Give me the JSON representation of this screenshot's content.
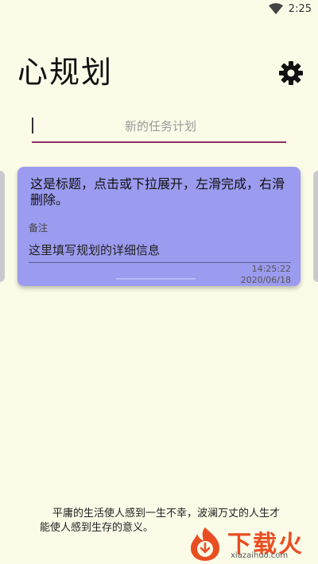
{
  "status_bar": {
    "time": "2:25",
    "wifi_icon": "wifi-icon"
  },
  "header": {
    "title": "心规划",
    "settings_icon": "gear-icon"
  },
  "task_input": {
    "placeholder": "新的任务计划",
    "value": ""
  },
  "card": {
    "title": "这是标题，点击或下拉展开，左滑完成，右滑删除。",
    "note_label": "备注",
    "note": "这里填写规划的详细信息",
    "time": "14:25:22",
    "date": "2020/06/18",
    "color": "#9b9bf0"
  },
  "quote": "平庸的生活使人感到一生不幸，波澜万丈的人生才能使人感到生存的意义。",
  "watermark": {
    "text": "下载火",
    "url": "xiazaihuo.com"
  },
  "colors": {
    "background": "#fbfbe8",
    "accent": "#8e2e63",
    "watermark": "#e94d22"
  }
}
